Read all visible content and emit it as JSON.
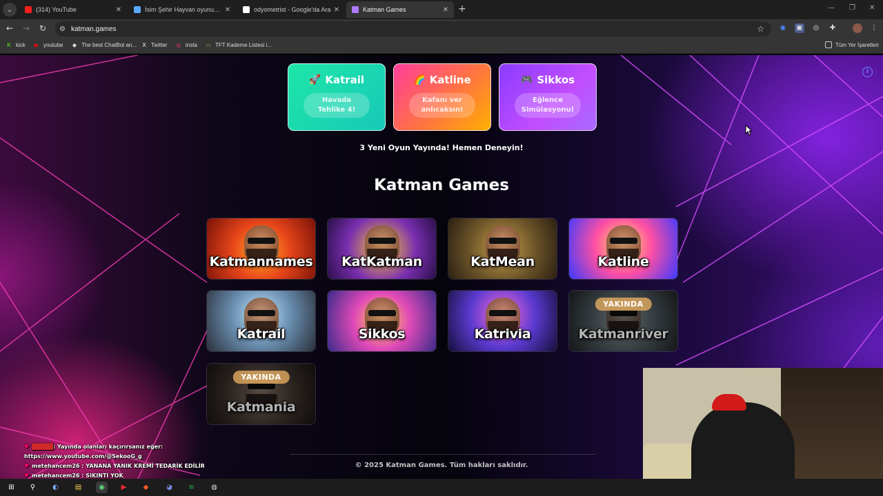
{
  "browser": {
    "tabs": [
      {
        "title": "(314) YouTube",
        "favicon_color": "#ff1e1e",
        "active": false
      },
      {
        "title": "İsim Şehir Hayvan oyununa katıl",
        "favicon_color": "#5aa8ff",
        "active": false
      },
      {
        "title": "odyometrist - Google'da Ara",
        "favicon_color": "#ffffff",
        "active": false
      },
      {
        "title": "Katman Games",
        "favicon_color": "#b07bff",
        "active": true
      }
    ],
    "url": "katman.games",
    "bookmarks": [
      {
        "label": "kick",
        "icon": "kick-icon",
        "color": "#53fc18"
      },
      {
        "label": "youtube",
        "icon": "youtube-icon",
        "color": "#ff0000"
      },
      {
        "label": "The best ChatBot an...",
        "icon": "chatbot-icon",
        "color": "#dddddd"
      },
      {
        "label": "Twitter",
        "icon": "x-icon",
        "color": "#ffffff"
      },
      {
        "label": "insta",
        "icon": "instagram-icon",
        "color": "#e1306c"
      },
      {
        "label": "TFT Kademe Listesi i...",
        "icon": "tft-icon",
        "color": "#c9a25a"
      }
    ],
    "all_bookmarks_label": "Tüm Yer İşaretleri"
  },
  "featured": [
    {
      "emoji": "🚀",
      "title": "Katrail",
      "subtitle": "Havada Tehlike 4!",
      "gradient": "linear-gradient(135deg,#1ee6a8,#17c9b8)"
    },
    {
      "emoji": "🌈",
      "title": "Katline",
      "subtitle": "Kafanı ver anlıcaksın!",
      "gradient": "linear-gradient(135deg,#ff3c9a 0%,#ff7a3a 60%,#ffb000 100%)"
    },
    {
      "emoji": "🎮",
      "title": "Sikkos",
      "subtitle": "Eğlence Simülasyonu!",
      "gradient": "linear-gradient(135deg,#8a3cff,#c24dff 60%,#a86bff)"
    }
  ],
  "announcement": "3 Yeni Oyun Yayında! Hemen Deneyin!",
  "site_title": "Katman Games",
  "games": [
    {
      "name": "Katmannames",
      "soon": false,
      "art": "radial-gradient(circle at 50% 55%,#ffb020 0%,#e8461a 45%,#7a1208 100%)"
    },
    {
      "name": "KatKatman",
      "soon": false,
      "art": "radial-gradient(circle at 50% 50%,#ffcc33 0%,#7a2fb0 55%,#2a0f4a 100%)"
    },
    {
      "name": "KatMean",
      "soon": false,
      "art": "radial-gradient(circle at 50% 50%,#c7a04a 0%,#6a5228 55%,#2b2012 100%)"
    },
    {
      "name": "Katline",
      "soon": false,
      "art": "radial-gradient(circle at 50% 45%,#ffe066 0%,#ff4fa3 45%,#3a3aff 100%)"
    },
    {
      "name": "Katrail",
      "soon": false,
      "art": "radial-gradient(circle at 50% 40%,#bfe8ff 0%,#6a8fb0 45%,#2a2f3a 100%)"
    },
    {
      "name": "Sikkos",
      "soon": false,
      "art": "radial-gradient(circle at 50% 50%,#ffd24a 0%,#e04ab8 45%,#3a2a8a 100%)"
    },
    {
      "name": "Katrivia",
      "soon": false,
      "art": "radial-gradient(circle at 50% 40%,#ff6bd8 0%,#5a3ad0 50%,#150f3a 100%)"
    },
    {
      "name": "Katmanriver",
      "soon": true,
      "art": "radial-gradient(circle at 50% 50%,#9fc0c8 0%,#4a6a7a 55%,#1f2a30 100%)"
    },
    {
      "name": "Katmania",
      "soon": true,
      "art": "radial-gradient(circle at 50% 50%,#b08a5a 0%,#5a3a2a 55%,#241612 100%)"
    }
  ],
  "soon_label": "YAKINDA",
  "footer": "© 2025 Katman Games. Tüm hakları saklıdır.",
  "chat": [
    {
      "user": "",
      "text": ": Yayında olanları kaçırırsanız eğer:",
      "hidden": true
    },
    {
      "user": "",
      "text": "https://www.youtube.com/@SekooG_g",
      "hidden": false
    },
    {
      "user": "metehancem26",
      "text": " : YANANA YANIK KREMİ TEDARİK EDİLİR",
      "hidden": false
    },
    {
      "user": "metehancem26",
      "text": " : SIKINTI YOK",
      "hidden": false
    }
  ],
  "taskbar": [
    "windows-start-icon",
    "search-icon",
    "steam-icon",
    "file-explorer-icon",
    "chrome-icon",
    "youtube-music-icon",
    "brave-icon",
    "discord-icon",
    "spotify-icon",
    "obs-icon"
  ]
}
